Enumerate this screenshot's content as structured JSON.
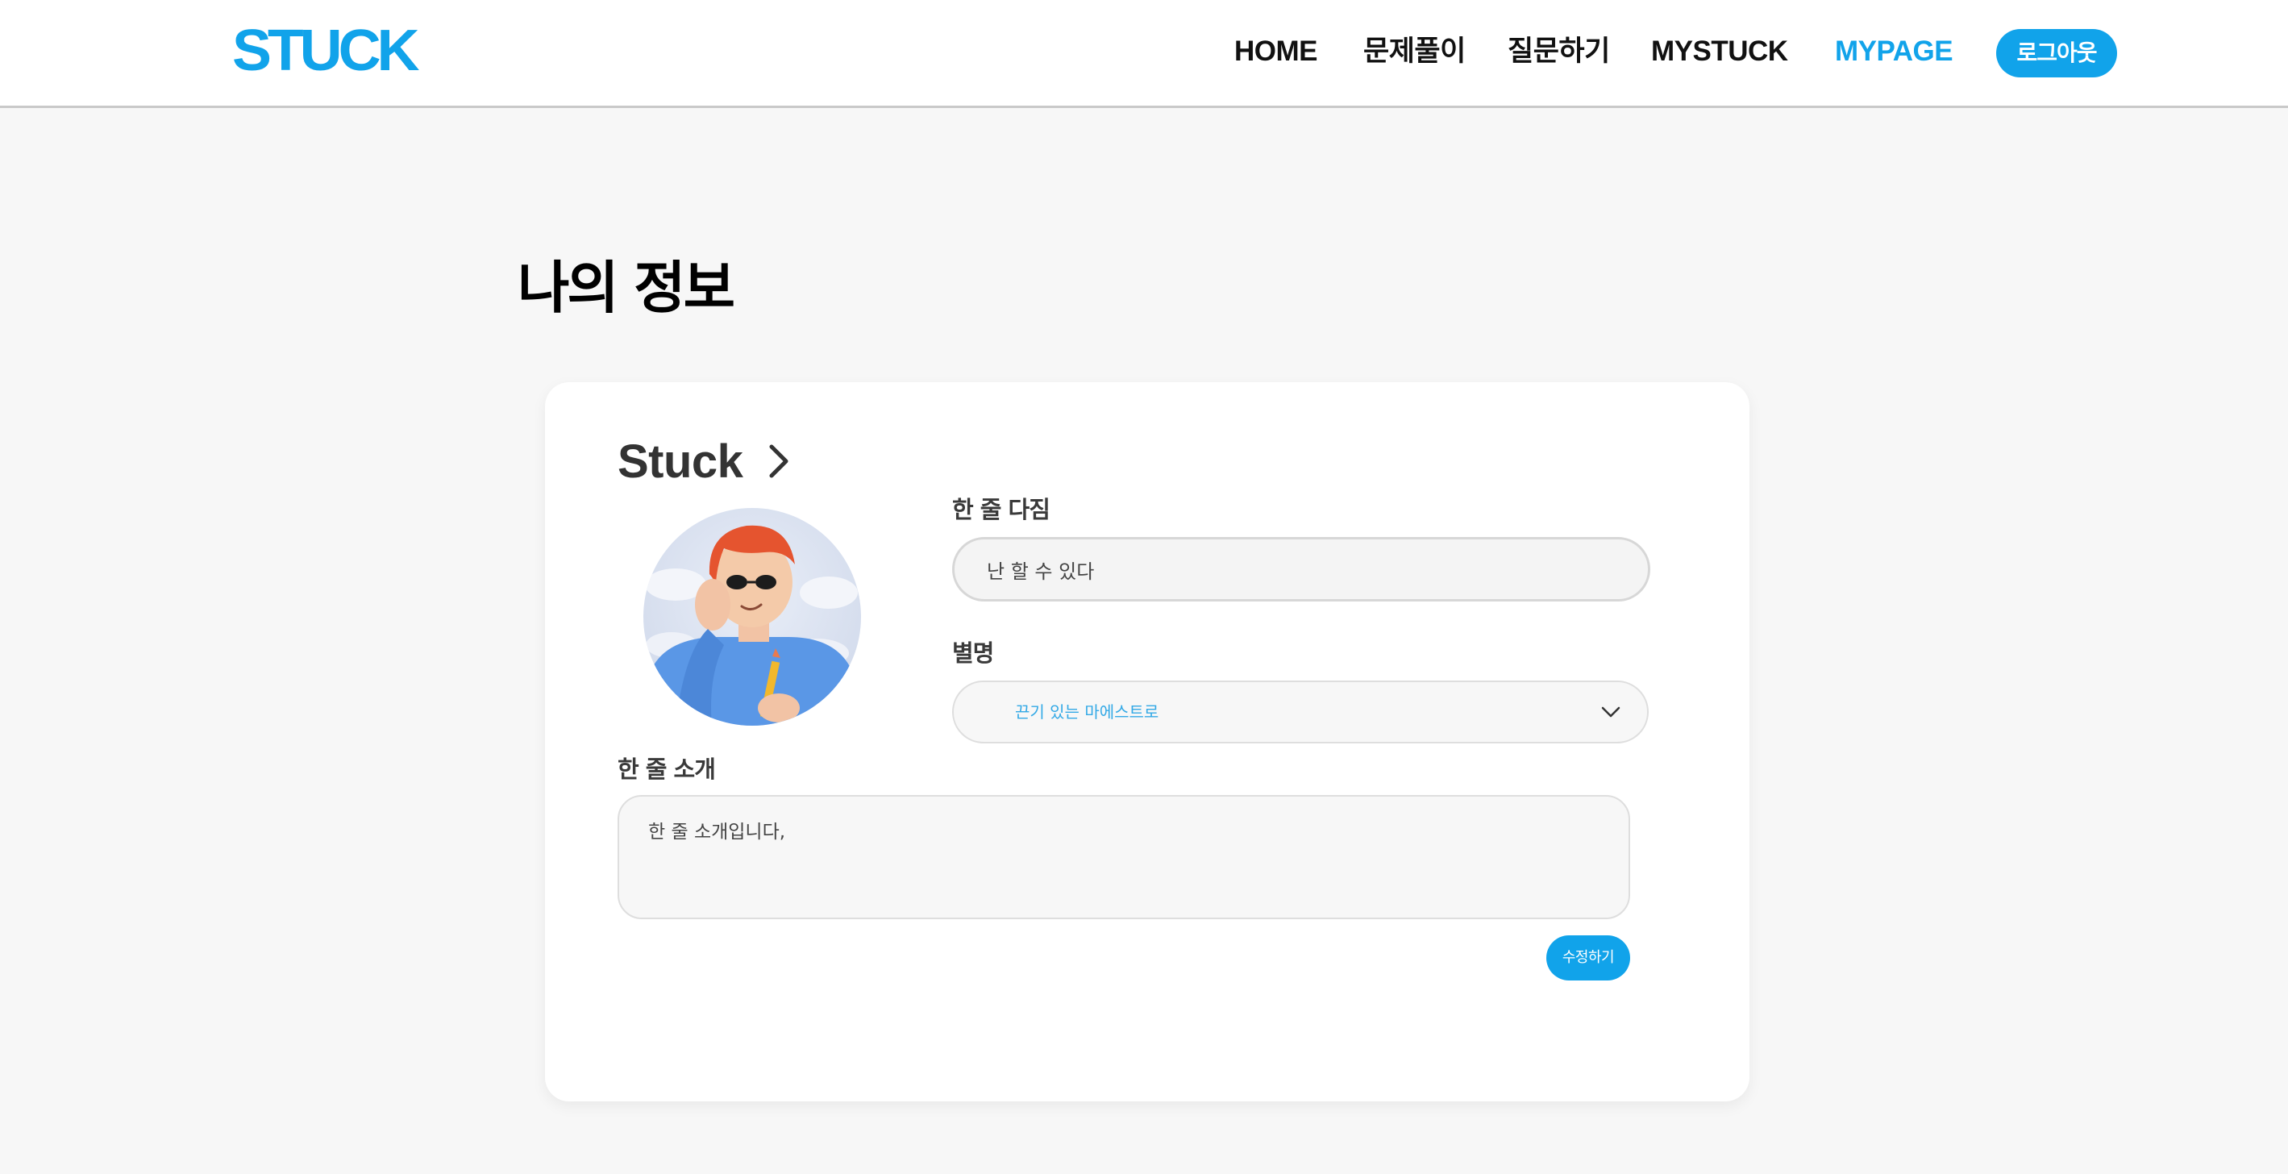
{
  "header": {
    "logo": "STUCK",
    "nav": {
      "home": "HOME",
      "solve": "문제풀이",
      "ask": "질문하기",
      "mystuck": "MYSTUCK",
      "mypage": "MYPAGE"
    },
    "logout_label": "로그아웃",
    "active_tab": "MYPAGE"
  },
  "page": {
    "title": "나의 정보"
  },
  "profile": {
    "username": "Stuck",
    "avatar_icon": "user-avatar-illustration",
    "resolution_label": "한 줄 다짐",
    "resolution_value": "난 할 수 있다",
    "nickname_label": "별명",
    "nickname_value": "끈기 있는 마에스트로",
    "intro_label": "한 줄 소개",
    "intro_value": "한 줄 소개입니다,",
    "edit_label": "수정하기"
  },
  "colors": {
    "accent": "#11a3ea",
    "background": "#f7f7f7",
    "card": "#ffffff"
  }
}
